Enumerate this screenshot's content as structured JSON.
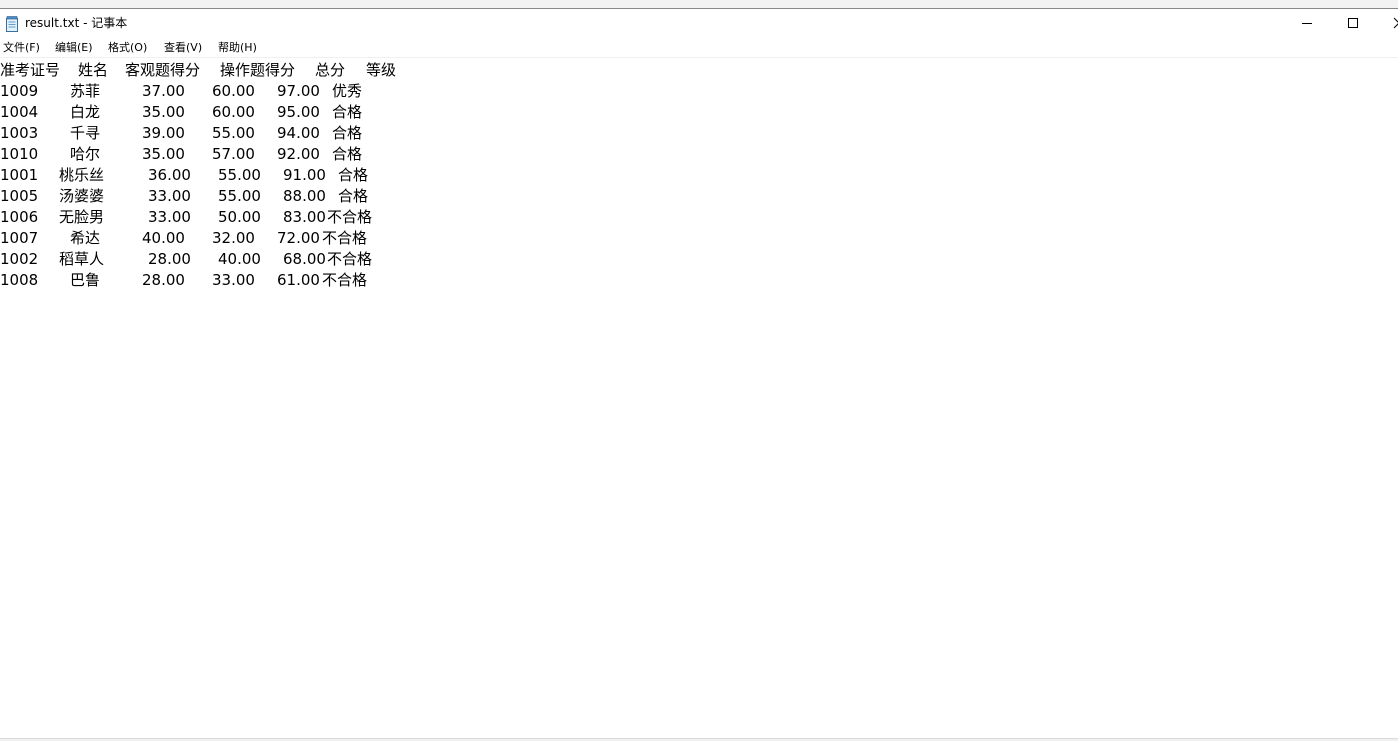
{
  "window": {
    "title": "result.txt - 记事本",
    "icon": "notepad-icon"
  },
  "controls": {
    "minimize_icon": "minimize-icon",
    "maximize_icon": "maximize-icon",
    "close_icon": "close-icon"
  },
  "menu": [
    "文件(F)",
    "编辑(E)",
    "格式(O)",
    "查看(V)",
    "帮助(H)"
  ],
  "document": {
    "header": [
      "准考证号",
      "姓名",
      "客观题得分",
      "操作题得分",
      "总分",
      "等级"
    ],
    "rows": [
      [
        "1009",
        "苏菲",
        "37.00",
        "60.00",
        "97.00",
        "优秀"
      ],
      [
        "1004",
        "白龙",
        "35.00",
        "60.00",
        "95.00",
        "合格"
      ],
      [
        "1003",
        "千寻",
        "39.00",
        "55.00",
        "94.00",
        "合格"
      ],
      [
        "1010",
        "哈尔",
        "35.00",
        "57.00",
        "92.00",
        "合格"
      ],
      [
        "1001",
        "桃乐丝",
        "36.00",
        "55.00",
        "91.00",
        "合格"
      ],
      [
        "1005",
        "汤婆婆",
        "33.00",
        "55.00",
        "88.00",
        "合格"
      ],
      [
        "1006",
        "无脸男",
        "33.00",
        "50.00",
        "83.00",
        "不合格"
      ],
      [
        "1007",
        "希达",
        "40.00",
        "32.00",
        "72.00",
        "不合格"
      ],
      [
        "1002",
        "稻草人",
        "28.00",
        "40.00",
        "68.00",
        "不合格"
      ],
      [
        "1008",
        "巴鲁",
        "28.00",
        "33.00",
        "61.00",
        "不合格"
      ]
    ]
  }
}
